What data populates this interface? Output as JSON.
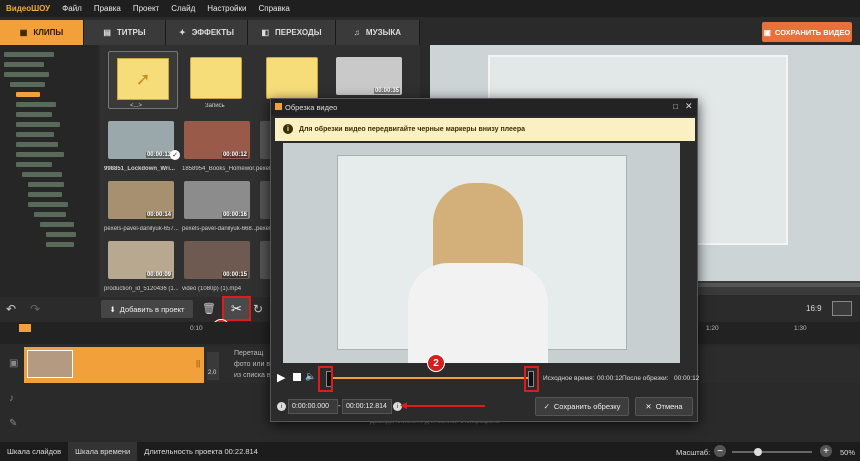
{
  "app": {
    "logo": "ВидеоШОУ",
    "menu": [
      "Файл",
      "Правка",
      "Проект",
      "Слайд",
      "Настройки",
      "Справка"
    ]
  },
  "tabs": [
    {
      "label": "КЛИПЫ",
      "icon": "film-icon"
    },
    {
      "label": "ТИТРЫ",
      "icon": "titles-icon"
    },
    {
      "label": "ЭФФЕКТЫ",
      "icon": "effects-icon"
    },
    {
      "label": "ПЕРЕХОДЫ",
      "icon": "transitions-icon"
    },
    {
      "label": "МУЗЫКА",
      "icon": "music-icon"
    }
  ],
  "save_video": "СОХРАНИТЬ ВИДЕО",
  "media": {
    "folders": [
      {
        "label": "<...>"
      },
      {
        "label": "Запись"
      },
      {
        "label": ""
      }
    ],
    "videos": [
      {
        "label": "",
        "duration": "00:00:35"
      },
      {
        "label": "998851_Lockdown_Wri...",
        "duration": "00:00:13"
      },
      {
        "label": "1858954_Books_Homewor...",
        "duration": "00:00:12"
      },
      {
        "label": "pexels",
        "duration": ""
      },
      {
        "label": "pexels-pavel-danilyuk-657...",
        "duration": "00:00:14"
      },
      {
        "label": "pexels-pavel-danilyuk-668...",
        "duration": "00:00:16"
      },
      {
        "label": "pexels",
        "duration": ""
      },
      {
        "label": "production_id_5120436 (1...",
        "duration": "00:00:09"
      },
      {
        "label": "video (1080p) (1).mp4",
        "duration": "00:00:15"
      },
      {
        "label": "",
        "duration": ""
      }
    ]
  },
  "controls": {
    "add_to_project": "Добавить в проект",
    "aspect": "16:9"
  },
  "ruler": {
    "ticks": [
      "0:10",
      "1:20",
      "1:30"
    ]
  },
  "timeline": {
    "clip_number": "2.0",
    "text_lines": [
      "Перетащ",
      "фото или в",
      "из списка в"
    ],
    "mic_hint": "Дважды кликните для записи с микрофона"
  },
  "bottom": {
    "slides_tab": "Шкала слайдов",
    "timeline_tab": "Шкала времени",
    "duration": "Длительность проекта 00:22.814",
    "zoom_label": "Масштаб:",
    "zoom_value": "50%"
  },
  "dialog": {
    "title": "Обрезка видео",
    "hint": "Для обрезки видео передвигайте черные маркеры внизу плеера",
    "source_time_label": "Исходное время:",
    "source_time": "00:00:12",
    "after_label": "После обрезки:",
    "after_time": "00:00:12",
    "start_value": "0:00:00.000",
    "dash": "-",
    "end_value": "00:00:12.814",
    "save_button": "Сохранить обрезку",
    "cancel_button": "Отмена"
  },
  "annotations": {
    "badge1": "1",
    "badge2": "2",
    "accent": "#e01b1b"
  }
}
